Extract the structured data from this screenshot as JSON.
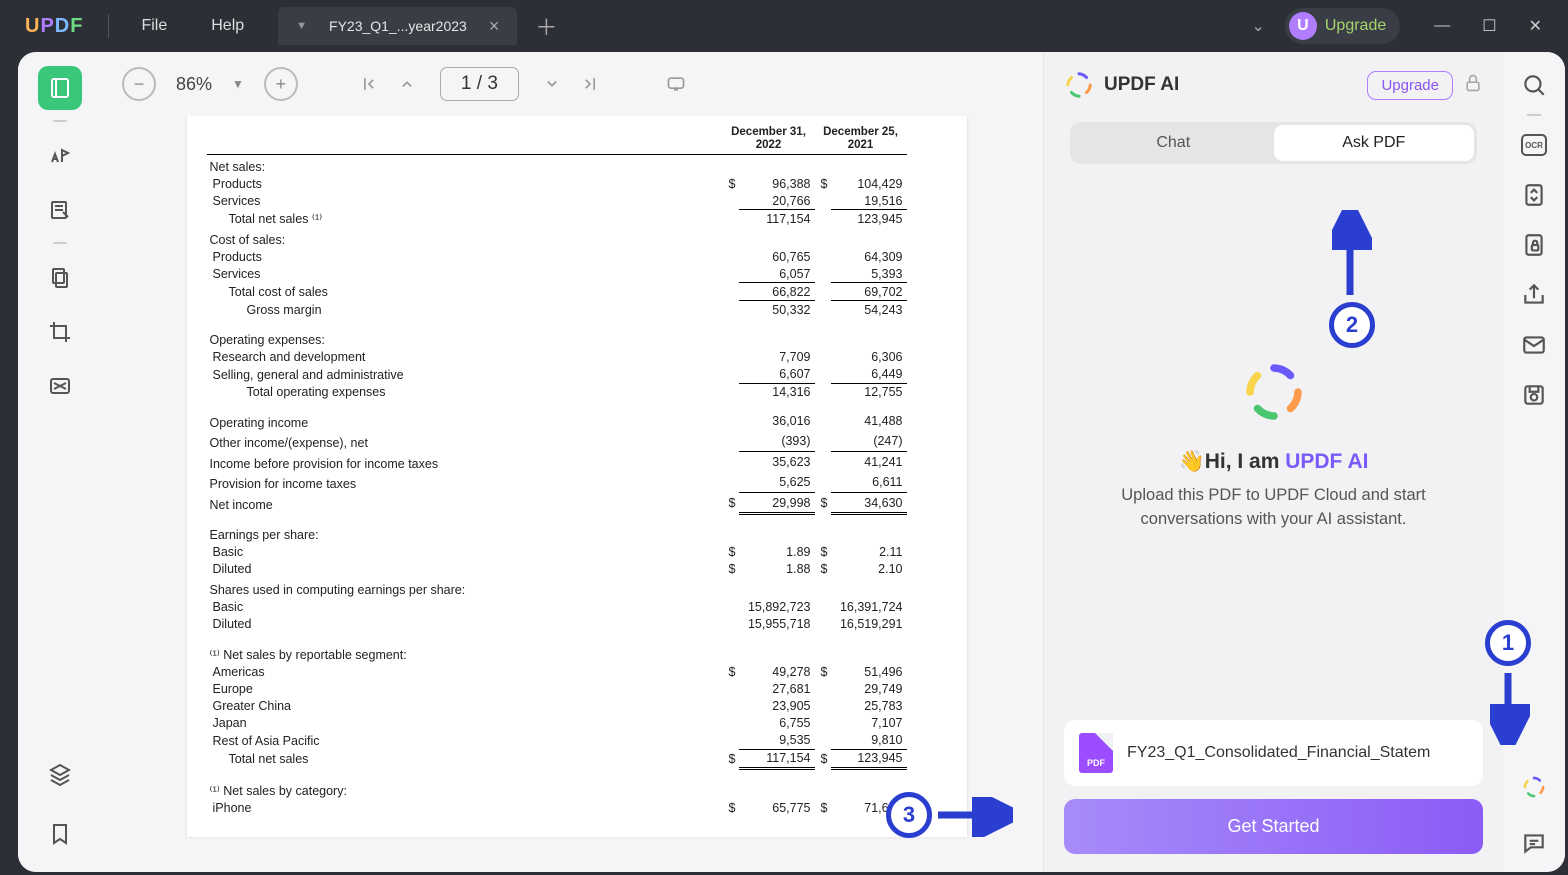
{
  "app": {
    "logo_letters": [
      "U",
      "P",
      "D",
      "F"
    ]
  },
  "menu": {
    "file": "File",
    "help": "Help"
  },
  "tab": {
    "title": "FY23_Q1_...year2023"
  },
  "titlebar": {
    "upgrade": "Upgrade",
    "upgrade_badge": "U"
  },
  "toolbar": {
    "zoom": "86%",
    "page_current": "1",
    "page_sep": "/",
    "page_total": "3"
  },
  "doc": {
    "col1": "December 31, 2022",
    "col2": "December 25, 2021",
    "rows": [
      {
        "t": "sect",
        "label": "Net sales:"
      },
      {
        "t": "row",
        "cls": "lbl",
        "label": "Products",
        "d1": "$",
        "v1": "96,388",
        "d2": "$",
        "v2": "104,429"
      },
      {
        "t": "row",
        "cls": "lbl",
        "label": "Services",
        "v1": "20,766",
        "v2": "19,516"
      },
      {
        "t": "row",
        "cls": "lbl2 ul",
        "label": "Total net sales ⁽¹⁾",
        "v1": "117,154",
        "v2": "123,945"
      },
      {
        "t": "sect",
        "label": "Cost of sales:"
      },
      {
        "t": "row",
        "cls": "lbl",
        "label": "Products",
        "v1": "60,765",
        "v2": "64,309"
      },
      {
        "t": "row",
        "cls": "lbl",
        "label": "Services",
        "v1": "6,057",
        "v2": "5,393"
      },
      {
        "t": "row",
        "cls": "lbl2 ul",
        "label": "Total cost of sales",
        "v1": "66,822",
        "v2": "69,702"
      },
      {
        "t": "row",
        "cls": "lbl3 ul",
        "label": "Gross margin",
        "v1": "50,332",
        "v2": "54,243"
      },
      {
        "t": "spacer"
      },
      {
        "t": "sect",
        "label": "Operating expenses:"
      },
      {
        "t": "row",
        "cls": "lbl",
        "label": "Research and development",
        "v1": "7,709",
        "v2": "6,306"
      },
      {
        "t": "row",
        "cls": "lbl",
        "label": "Selling, general and administrative",
        "v1": "6,607",
        "v2": "6,449"
      },
      {
        "t": "row",
        "cls": "lbl3 ul",
        "label": "Total operating expenses",
        "v1": "14,316",
        "v2": "12,755"
      },
      {
        "t": "spacer"
      },
      {
        "t": "row",
        "cls": "sect",
        "label": "Operating income",
        "v1": "36,016",
        "v2": "41,488"
      },
      {
        "t": "row",
        "cls": "sect",
        "label": "Other income/(expense), net",
        "v1": "(393)",
        "v2": "(247)"
      },
      {
        "t": "row",
        "cls": "sect ul",
        "label": "Income before provision for income taxes",
        "v1": "35,623",
        "v2": "41,241"
      },
      {
        "t": "row",
        "cls": "sect",
        "label": "Provision for income taxes",
        "v1": "5,625",
        "v2": "6,611"
      },
      {
        "t": "row",
        "cls": "sect udl",
        "label": "Net income",
        "d1": "$",
        "v1": "29,998",
        "d2": "$",
        "v2": "34,630"
      },
      {
        "t": "spacer"
      },
      {
        "t": "sect",
        "label": "Earnings per share:"
      },
      {
        "t": "row",
        "cls": "lbl",
        "label": "Basic",
        "d1": "$",
        "v1": "1.89",
        "d2": "$",
        "v2": "2.11"
      },
      {
        "t": "row",
        "cls": "lbl",
        "label": "Diluted",
        "d1": "$",
        "v1": "1.88",
        "d2": "$",
        "v2": "2.10"
      },
      {
        "t": "sect",
        "label": "Shares used in computing earnings per share:"
      },
      {
        "t": "row",
        "cls": "lbl",
        "label": "Basic",
        "v1": "15,892,723",
        "v2": "16,391,724"
      },
      {
        "t": "row",
        "cls": "lbl",
        "label": "Diluted",
        "v1": "15,955,718",
        "v2": "16,519,291"
      },
      {
        "t": "spacer"
      },
      {
        "t": "sect",
        "label": "⁽¹⁾ Net sales by reportable segment:"
      },
      {
        "t": "row",
        "cls": "lbl",
        "label": "Americas",
        "d1": "$",
        "v1": "49,278",
        "d2": "$",
        "v2": "51,496"
      },
      {
        "t": "row",
        "cls": "lbl",
        "label": "Europe",
        "v1": "27,681",
        "v2": "29,749"
      },
      {
        "t": "row",
        "cls": "lbl",
        "label": "Greater China",
        "v1": "23,905",
        "v2": "25,783"
      },
      {
        "t": "row",
        "cls": "lbl",
        "label": "Japan",
        "v1": "6,755",
        "v2": "7,107"
      },
      {
        "t": "row",
        "cls": "lbl",
        "label": "Rest of Asia Pacific",
        "v1": "9,535",
        "v2": "9,810"
      },
      {
        "t": "row",
        "cls": "lbl2 udl",
        "label": "Total net sales",
        "d1": "$",
        "v1": "117,154",
        "d2": "$",
        "v2": "123,945"
      },
      {
        "t": "spacer"
      },
      {
        "t": "sect",
        "label": "⁽¹⁾ Net sales by category:"
      },
      {
        "t": "row",
        "cls": "lbl",
        "label": "iPhone",
        "d1": "$",
        "v1": "65,775",
        "d2": "$",
        "v2": "71,628"
      }
    ]
  },
  "ai": {
    "title": "UPDF AI",
    "upgrade": "Upgrade",
    "tab_chat": "Chat",
    "tab_ask": "Ask PDF",
    "hi_prefix": "Hi, I am ",
    "hi_brand": "UPDF AI",
    "desc": "Upload this PDF to UPDF Cloud and start conversations with your AI assistant.",
    "filename": "FY23_Q1_Consolidated_Financial_Statem",
    "pdf_badge": "PDF",
    "get_started": "Get Started"
  },
  "right_tools": {
    "ocr": "OCR"
  },
  "annot": {
    "n1": "1",
    "n2": "2",
    "n3": "3"
  }
}
